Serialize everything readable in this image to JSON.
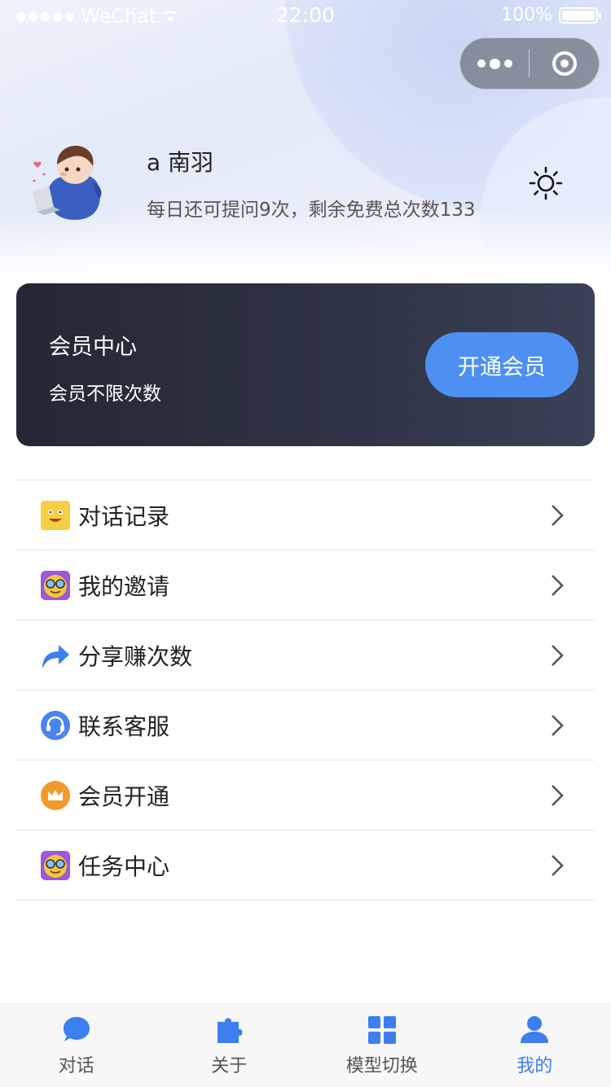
{
  "status_bar": {
    "carrier": "WeChat",
    "time": "22:00",
    "battery_percent": "100%"
  },
  "profile": {
    "name": "a 南羽",
    "quota_text": "每日还可提问9次，剩余免费总次数133"
  },
  "member_card": {
    "title": "会员中心",
    "subtitle": "会员不限次数",
    "button_label": "开通会员"
  },
  "menu": {
    "items": [
      {
        "label": "对话记录",
        "icon": "smiley-face-icon"
      },
      {
        "label": "我的邀请",
        "icon": "sunglasses-face-icon"
      },
      {
        "label": "分享赚次数",
        "icon": "share-arrow-icon"
      },
      {
        "label": "联系客服",
        "icon": "headset-icon"
      },
      {
        "label": "会员开通",
        "icon": "crown-icon"
      },
      {
        "label": "任务中心",
        "icon": "sunglasses-face-icon"
      }
    ]
  },
  "tab_bar": {
    "tabs": [
      {
        "label": "对话",
        "icon": "chat-bubble-icon",
        "active": false
      },
      {
        "label": "关于",
        "icon": "puzzle-icon",
        "active": false
      },
      {
        "label": "模型切换",
        "icon": "grid-icon",
        "active": false
      },
      {
        "label": "我的",
        "icon": "user-icon",
        "active": true
      }
    ]
  },
  "colors": {
    "accent": "#4e90f2",
    "tab_active": "#3d7ef0",
    "card_dark": "#2a2e3c"
  }
}
